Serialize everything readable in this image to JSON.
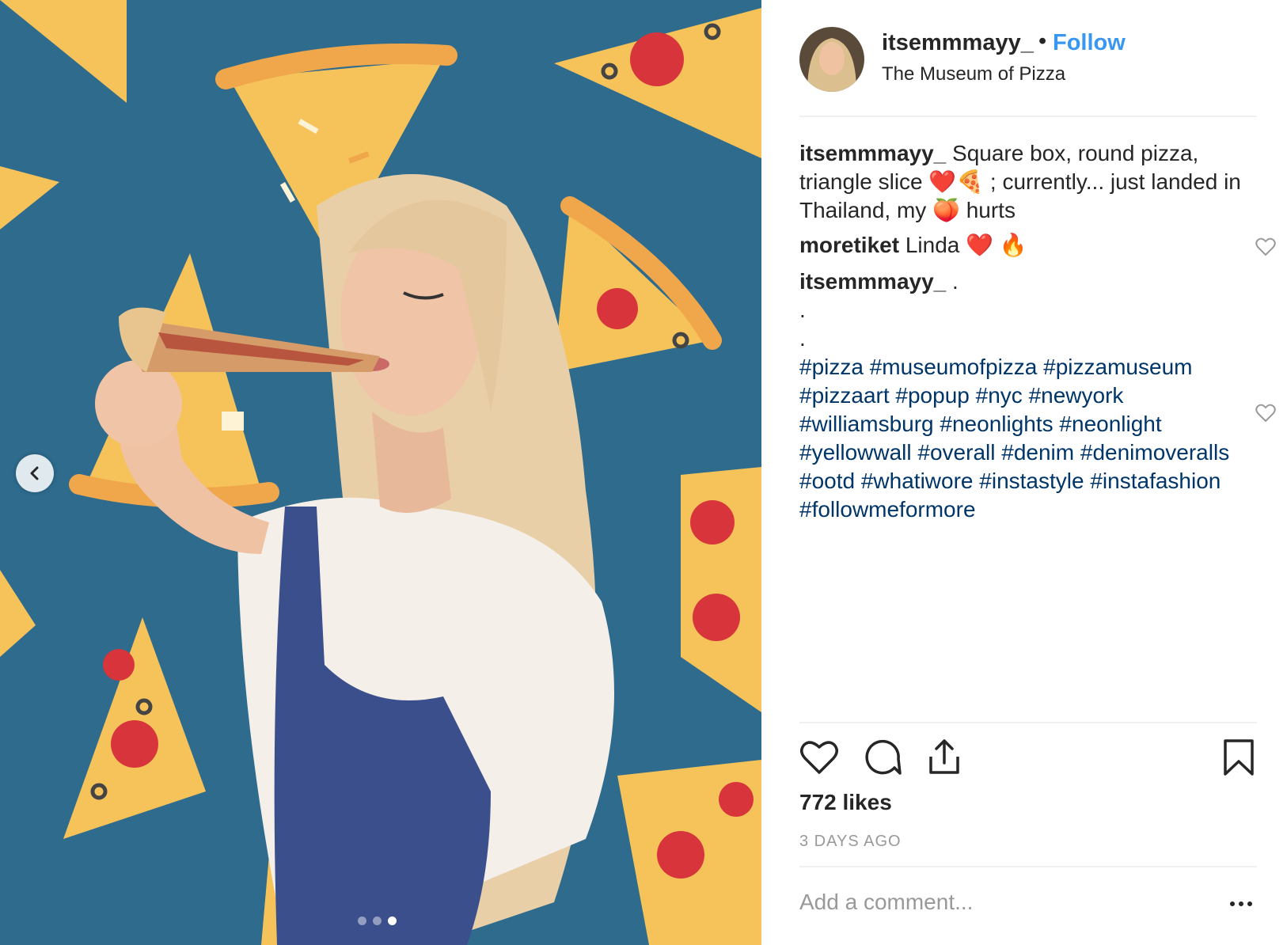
{
  "post": {
    "username": "itsemmmayy_",
    "separator": "•",
    "follow_label": "Follow",
    "location": "The Museum of Pizza",
    "carousel": {
      "count": 3,
      "active_index": 2
    }
  },
  "caption": {
    "username": "itsemmmayy_",
    "text": "Square box, round pizza, triangle slice ❤️🍕 ; currently... just landed in Thailand, my 🍑 hurts"
  },
  "comments": [
    {
      "username": "moretiket",
      "text": "Linda ❤️ 🔥"
    },
    {
      "username": "itsemmmayy_",
      "lines": [
        ".",
        ".",
        "."
      ],
      "hashtags": [
        "#pizza",
        "#museumofpizza",
        "#pizzamuseum",
        "#pizzaart",
        "#popup",
        "#nyc",
        "#newyork",
        "#williamsburg",
        "#neonlights",
        "#neonlight",
        "#yellowwall",
        "#overall",
        "#denim",
        "#denimoveralls",
        "#ootd",
        "#whatiwore",
        "#instastyle",
        "#instafashion",
        "#followmeformore"
      ]
    }
  ],
  "stats": {
    "likes": "772 likes",
    "time": "3 DAYS AGO"
  },
  "comment_box": {
    "placeholder": "Add a comment..."
  },
  "colors": {
    "follow": "#3897f0",
    "hashtag": "#003569",
    "muted": "#999999",
    "wall": "#2d6a8e"
  },
  "icons": [
    "chevron-left-icon",
    "heart-icon",
    "comment-icon",
    "share-icon",
    "bookmark-icon",
    "more-icon"
  ]
}
